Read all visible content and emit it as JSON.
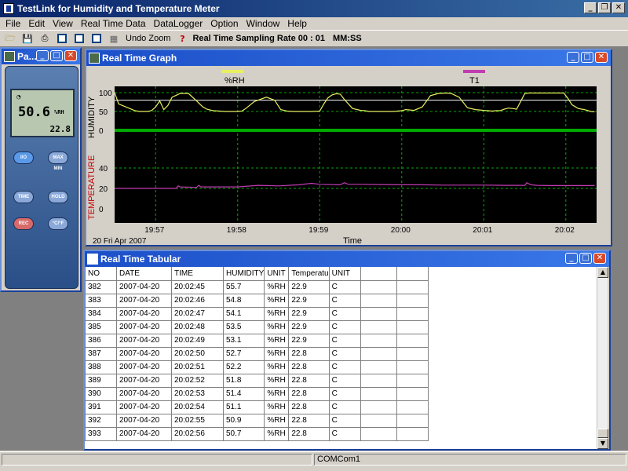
{
  "app": {
    "title": "TestLink for Humidity and Temperature Meter"
  },
  "menu": [
    "File",
    "Edit",
    "View",
    "Real Time Data",
    "DataLogger",
    "Option",
    "Window",
    "Help"
  ],
  "toolbar": {
    "undo_zoom": "Undo Zoom",
    "help": "?",
    "rate_label": "Real Time Sampling Rate 00 : 01",
    "rate_unit": "MM:SS"
  },
  "panel": {
    "title": "Pa...",
    "lcd_main": "50.6",
    "lcd_unit": "%RH",
    "lcd_temp": "22.8",
    "buttons": {
      "power": "I/O",
      "maxmin": "MAX MIN",
      "time": "TIME",
      "hold": "HOLD",
      "rec": "REC",
      "cf": "°C/°F"
    }
  },
  "graph": {
    "title": "Real Time Graph",
    "legend_rh": "%RH",
    "legend_t1": "T1",
    "ylabel_h": "HUMIDITY",
    "ylabel_t": "TEMPERATURE",
    "xlabel": "Time",
    "date": "20 Fri Apr 2007",
    "colors": {
      "rh": "#e8f060",
      "t1": "#c03cb0",
      "grid": "#00cc00",
      "bg": "#000000"
    }
  },
  "chart_data": {
    "type": "line",
    "xlabel": "Time",
    "x_ticks": [
      "19:57",
      "19:58",
      "19:59",
      "20:00",
      "20:01",
      "20:02"
    ],
    "humidity_axis": {
      "label": "HUMIDITY",
      "ticks": [
        100,
        50,
        0
      ],
      "ylim": [
        0,
        100
      ]
    },
    "temperature_axis": {
      "label": "TEMPERATURE",
      "ticks": [
        40,
        20,
        0
      ],
      "ylim": [
        0,
        40
      ]
    },
    "series": [
      {
        "name": "%RH",
        "unit": "minutes from 19:56",
        "x": [
          0.0,
          0.05,
          0.1,
          0.5,
          0.6,
          0.7,
          0.8,
          0.9,
          1.0,
          1.1,
          1.2,
          1.3,
          1.4,
          1.5,
          1.6,
          1.8,
          2.0,
          2.15,
          2.25,
          2.4,
          2.55,
          2.7,
          2.8,
          2.95,
          3.1,
          3.2,
          3.4,
          3.55,
          3.7,
          3.9,
          4.05,
          4.2,
          4.35,
          4.5,
          4.6,
          4.8,
          5.0,
          5.1,
          5.2,
          5.3,
          5.4,
          5.5,
          5.6,
          5.8,
          6.0,
          6.1,
          6.2,
          6.35,
          6.5,
          6.8,
          7.0,
          7.1,
          7.3,
          7.5,
          7.7,
          7.9,
          8.1,
          8.2,
          8.4,
          8.6,
          8.8,
          9.0,
          9.1,
          9.2,
          9.3,
          9.4,
          9.5,
          9.6,
          9.7,
          9.8,
          10.0,
          10.1,
          10.2,
          10.3,
          10.5,
          10.7,
          10.85,
          10.95,
          11.05,
          11.15,
          11.3,
          11.45,
          11.55,
          11.6,
          11.7
        ],
        "values": [
          100,
          85,
          70,
          52,
          50,
          50,
          50,
          52,
          62,
          78,
          55,
          66,
          88,
          93,
          98,
          98,
          78,
          62,
          56,
          52,
          51,
          50,
          50,
          50,
          51,
          58,
          76,
          82,
          88,
          80,
          55,
          51,
          50,
          50,
          50,
          50,
          51,
          70,
          86,
          94,
          97,
          96,
          82,
          58,
          53,
          52,
          50,
          50,
          50,
          50,
          52,
          55,
          53,
          62,
          92,
          98,
          99,
          98,
          88,
          60,
          55,
          53,
          52,
          51,
          52,
          52,
          56,
          59,
          58,
          56,
          98,
          99,
          99,
          99,
          99,
          99,
          99,
          99,
          85,
          68,
          58,
          55,
          52,
          50,
          49
        ]
      },
      {
        "name": "T1",
        "unit": "minutes from 19:56",
        "x": [
          0.0,
          0.5,
          1.0,
          1.5,
          1.55,
          1.6,
          2.0,
          2.05,
          2.1,
          3.0,
          3.5,
          4.0,
          4.5,
          4.8,
          5.0,
          5.5,
          5.6,
          5.7,
          6.0,
          6.5,
          7.0,
          7.5,
          8.0,
          8.5,
          9.0,
          9.5,
          10.0,
          10.05,
          10.1,
          10.15,
          10.3,
          10.6,
          10.8,
          11.0,
          11.5,
          11.7
        ],
        "values": [
          20.0,
          20.0,
          20.0,
          20.0,
          22.5,
          21.5,
          21.0,
          23.0,
          21.5,
          21.5,
          23.0,
          22.5,
          23.5,
          25.0,
          24.0,
          23.5,
          25.5,
          24.0,
          24.0,
          23.8,
          23.5,
          23.5,
          23.2,
          23.2,
          23.2,
          23.0,
          23.0,
          25.5,
          24.5,
          23.5,
          23.0,
          22.8,
          22.8,
          22.8,
          22.8,
          22.8
        ]
      }
    ],
    "grid": true,
    "legend": "top"
  },
  "tabular": {
    "title": "Real Time Tabular",
    "headers": [
      "NO",
      "DATE",
      "TIME",
      "HUMIDITY",
      "UNIT",
      "Temperatu",
      "UNIT",
      "",
      ""
    ],
    "rows": [
      [
        "382",
        "2007-04-20",
        "20:02:45",
        "55.7",
        "%RH",
        "22.9",
        "C",
        "",
        ""
      ],
      [
        "383",
        "2007-04-20",
        "20:02:46",
        "54.8",
        "%RH",
        "22.9",
        "C",
        "",
        ""
      ],
      [
        "384",
        "2007-04-20",
        "20:02:47",
        "54.1",
        "%RH",
        "22.9",
        "C",
        "",
        ""
      ],
      [
        "385",
        "2007-04-20",
        "20:02:48",
        "53.5",
        "%RH",
        "22.9",
        "C",
        "",
        ""
      ],
      [
        "386",
        "2007-04-20",
        "20:02:49",
        "53.1",
        "%RH",
        "22.9",
        "C",
        "",
        ""
      ],
      [
        "387",
        "2007-04-20",
        "20:02:50",
        "52.7",
        "%RH",
        "22.8",
        "C",
        "",
        ""
      ],
      [
        "388",
        "2007-04-20",
        "20:02:51",
        "52.2",
        "%RH",
        "22.8",
        "C",
        "",
        ""
      ],
      [
        "389",
        "2007-04-20",
        "20:02:52",
        "51.8",
        "%RH",
        "22.8",
        "C",
        "",
        ""
      ],
      [
        "390",
        "2007-04-20",
        "20:02:53",
        "51.4",
        "%RH",
        "22.8",
        "C",
        "",
        ""
      ],
      [
        "391",
        "2007-04-20",
        "20:02:54",
        "51.1",
        "%RH",
        "22.8",
        "C",
        "",
        ""
      ],
      [
        "392",
        "2007-04-20",
        "20:02:55",
        "50.9",
        "%RH",
        "22.8",
        "C",
        "",
        ""
      ],
      [
        "393",
        "2007-04-20",
        "20:02:56",
        "50.7",
        "%RH",
        "22.8",
        "C",
        "",
        ""
      ]
    ]
  },
  "status": {
    "port": "COMCom1"
  }
}
